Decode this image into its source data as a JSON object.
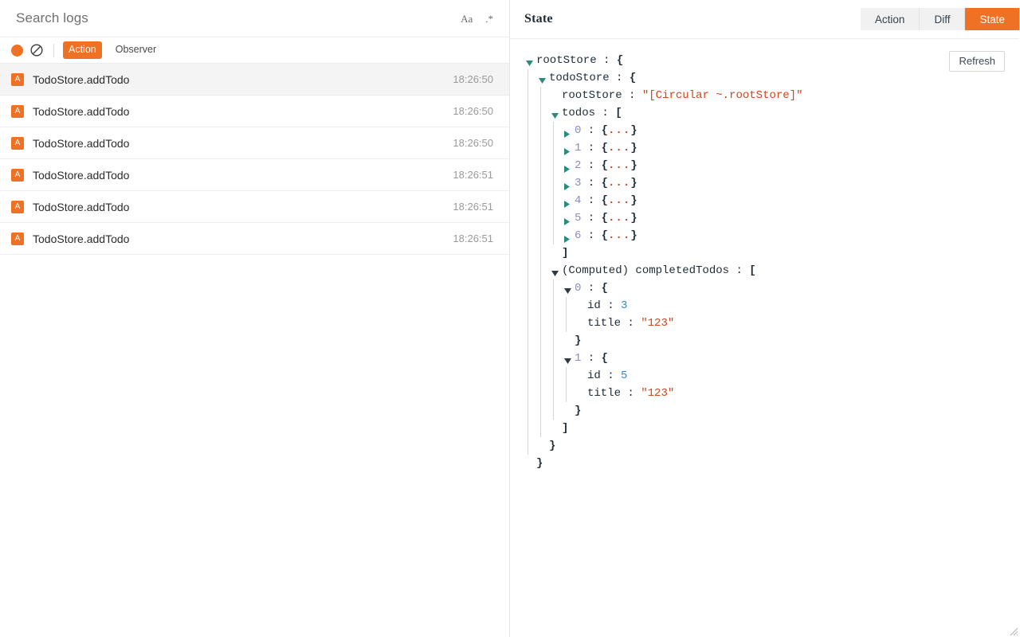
{
  "left_panel": {
    "search": {
      "placeholder": "Search logs",
      "value": "",
      "match_case_icon_label": "Aa",
      "regex_icon_label": ".*"
    },
    "toolbar": {
      "record_label": "",
      "clear_label": "",
      "filters": [
        {
          "label": "Action",
          "active": true
        },
        {
          "label": "Observer",
          "active": false
        }
      ]
    },
    "logs": {
      "badge_letter": "A",
      "rows": [
        {
          "name": "TodoStore.addTodo",
          "time": "18:26:50",
          "selected": true
        },
        {
          "name": "TodoStore.addTodo",
          "time": "18:26:50",
          "selected": false
        },
        {
          "name": "TodoStore.addTodo",
          "time": "18:26:50",
          "selected": false
        },
        {
          "name": "TodoStore.addTodo",
          "time": "18:26:51",
          "selected": false
        },
        {
          "name": "TodoStore.addTodo",
          "time": "18:26:51",
          "selected": false
        },
        {
          "name": "TodoStore.addTodo",
          "time": "18:26:51",
          "selected": false
        }
      ]
    }
  },
  "right_panel": {
    "title": "State",
    "tabs": [
      {
        "label": "Action",
        "active": false
      },
      {
        "label": "Diff",
        "active": false
      },
      {
        "label": "State",
        "active": true
      }
    ],
    "refresh_label": "Refresh",
    "tree": [
      {
        "depth": 0,
        "caret": "open",
        "parts": [
          {
            "t": "key",
            "v": "rootStore"
          },
          {
            "t": "colon",
            "v": " : "
          },
          {
            "t": "brace",
            "v": "{"
          }
        ]
      },
      {
        "depth": 1,
        "caret": "open",
        "parts": [
          {
            "t": "key",
            "v": "todoStore"
          },
          {
            "t": "colon",
            "v": " : "
          },
          {
            "t": "brace",
            "v": "{"
          }
        ]
      },
      {
        "depth": 2,
        "caret": "none",
        "parts": [
          {
            "t": "key",
            "v": "rootStore"
          },
          {
            "t": "colon",
            "v": " : "
          },
          {
            "t": "str",
            "v": "\"[Circular ~.rootStore]\""
          }
        ]
      },
      {
        "depth": 2,
        "caret": "open",
        "parts": [
          {
            "t": "key",
            "v": "todos"
          },
          {
            "t": "colon",
            "v": " : "
          },
          {
            "t": "brace",
            "v": "["
          }
        ]
      },
      {
        "depth": 3,
        "caret": "closed",
        "parts": [
          {
            "t": "idx",
            "v": "0"
          },
          {
            "t": "colon",
            "v": " : "
          },
          {
            "t": "brace",
            "v": "{"
          },
          {
            "t": "dots",
            "v": "..."
          },
          {
            "t": "brace",
            "v": "}"
          }
        ]
      },
      {
        "depth": 3,
        "caret": "closed",
        "parts": [
          {
            "t": "idx",
            "v": "1"
          },
          {
            "t": "colon",
            "v": " : "
          },
          {
            "t": "brace",
            "v": "{"
          },
          {
            "t": "dots",
            "v": "..."
          },
          {
            "t": "brace",
            "v": "}"
          }
        ]
      },
      {
        "depth": 3,
        "caret": "closed",
        "parts": [
          {
            "t": "idx",
            "v": "2"
          },
          {
            "t": "colon",
            "v": " : "
          },
          {
            "t": "brace",
            "v": "{"
          },
          {
            "t": "dots",
            "v": "..."
          },
          {
            "t": "brace",
            "v": "}"
          }
        ]
      },
      {
        "depth": 3,
        "caret": "closed",
        "parts": [
          {
            "t": "idx",
            "v": "3"
          },
          {
            "t": "colon",
            "v": " : "
          },
          {
            "t": "brace",
            "v": "{"
          },
          {
            "t": "dots",
            "v": "..."
          },
          {
            "t": "brace",
            "v": "}"
          }
        ]
      },
      {
        "depth": 3,
        "caret": "closed",
        "parts": [
          {
            "t": "idx",
            "v": "4"
          },
          {
            "t": "colon",
            "v": " : "
          },
          {
            "t": "brace",
            "v": "{"
          },
          {
            "t": "dots",
            "v": "..."
          },
          {
            "t": "brace",
            "v": "}"
          }
        ]
      },
      {
        "depth": 3,
        "caret": "closed",
        "parts": [
          {
            "t": "idx",
            "v": "5"
          },
          {
            "t": "colon",
            "v": " : "
          },
          {
            "t": "brace",
            "v": "{"
          },
          {
            "t": "dots",
            "v": "..."
          },
          {
            "t": "brace",
            "v": "}"
          }
        ]
      },
      {
        "depth": 3,
        "caret": "closed",
        "parts": [
          {
            "t": "idx",
            "v": "6"
          },
          {
            "t": "colon",
            "v": " : "
          },
          {
            "t": "brace",
            "v": "{"
          },
          {
            "t": "dots",
            "v": "..."
          },
          {
            "t": "brace",
            "v": "}"
          }
        ]
      },
      {
        "depth": 2,
        "caret": "none",
        "parts": [
          {
            "t": "brace",
            "v": "]"
          }
        ]
      },
      {
        "depth": 2,
        "caret": "open-dark",
        "parts": [
          {
            "t": "key",
            "v": "(Computed) completedTodos"
          },
          {
            "t": "colon",
            "v": " : "
          },
          {
            "t": "brace",
            "v": "["
          }
        ]
      },
      {
        "depth": 3,
        "caret": "open-dark",
        "parts": [
          {
            "t": "idx",
            "v": "0"
          },
          {
            "t": "colon",
            "v": " : "
          },
          {
            "t": "brace",
            "v": "{"
          }
        ]
      },
      {
        "depth": 4,
        "caret": "none",
        "parts": [
          {
            "t": "key",
            "v": "id"
          },
          {
            "t": "colon",
            "v": " : "
          },
          {
            "t": "num",
            "v": "3"
          }
        ]
      },
      {
        "depth": 4,
        "caret": "none",
        "parts": [
          {
            "t": "key",
            "v": "title"
          },
          {
            "t": "colon",
            "v": " : "
          },
          {
            "t": "str",
            "v": "\"123\""
          }
        ]
      },
      {
        "depth": 3,
        "caret": "none",
        "parts": [
          {
            "t": "brace",
            "v": "}"
          }
        ]
      },
      {
        "depth": 3,
        "caret": "open-dark",
        "parts": [
          {
            "t": "idx",
            "v": "1"
          },
          {
            "t": "colon",
            "v": " : "
          },
          {
            "t": "brace",
            "v": "{"
          }
        ]
      },
      {
        "depth": 4,
        "caret": "none",
        "parts": [
          {
            "t": "key",
            "v": "id"
          },
          {
            "t": "colon",
            "v": " : "
          },
          {
            "t": "num",
            "v": "5"
          }
        ]
      },
      {
        "depth": 4,
        "caret": "none",
        "parts": [
          {
            "t": "key",
            "v": "title"
          },
          {
            "t": "colon",
            "v": " : "
          },
          {
            "t": "str",
            "v": "\"123\""
          }
        ]
      },
      {
        "depth": 3,
        "caret": "none",
        "parts": [
          {
            "t": "brace",
            "v": "}"
          }
        ]
      },
      {
        "depth": 2,
        "caret": "none",
        "parts": [
          {
            "t": "brace",
            "v": "]"
          }
        ]
      },
      {
        "depth": 1,
        "caret": "none",
        "parts": [
          {
            "t": "brace",
            "v": "}"
          }
        ]
      },
      {
        "depth": 0,
        "caret": "none",
        "parts": [
          {
            "t": "brace",
            "v": "}"
          }
        ]
      }
    ]
  },
  "colors": {
    "accent": "#ef7124",
    "string": "#d0451b",
    "number": "#2b8ae2",
    "index": "#8a8ac8",
    "caret_teal": "#2a8a7e",
    "caret_dark": "#2d3b47",
    "text": "#1f2b36"
  }
}
